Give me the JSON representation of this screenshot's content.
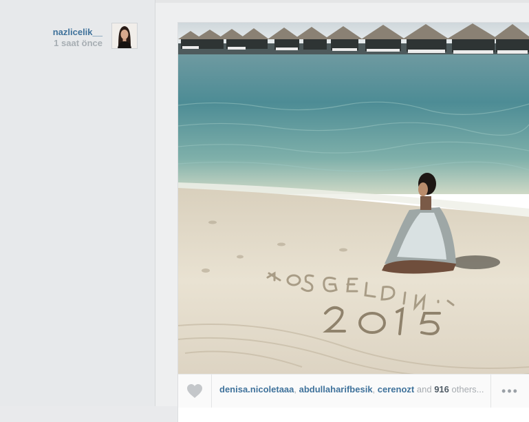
{
  "post": {
    "username": "nazlicelik__",
    "time_ago": "1 saat önce",
    "sand_text": "HOŞGELDİN 2015",
    "likes": {
      "users": [
        "denisa.nicoletaaa",
        "abdullaharifbesik",
        "cerenozt"
      ],
      "separator": ", ",
      "and_word": "and",
      "count": "916",
      "others_word": "others..."
    },
    "more_label": "•••"
  },
  "icons": {
    "like": "heart-icon",
    "more": "ellipsis-icon"
  }
}
